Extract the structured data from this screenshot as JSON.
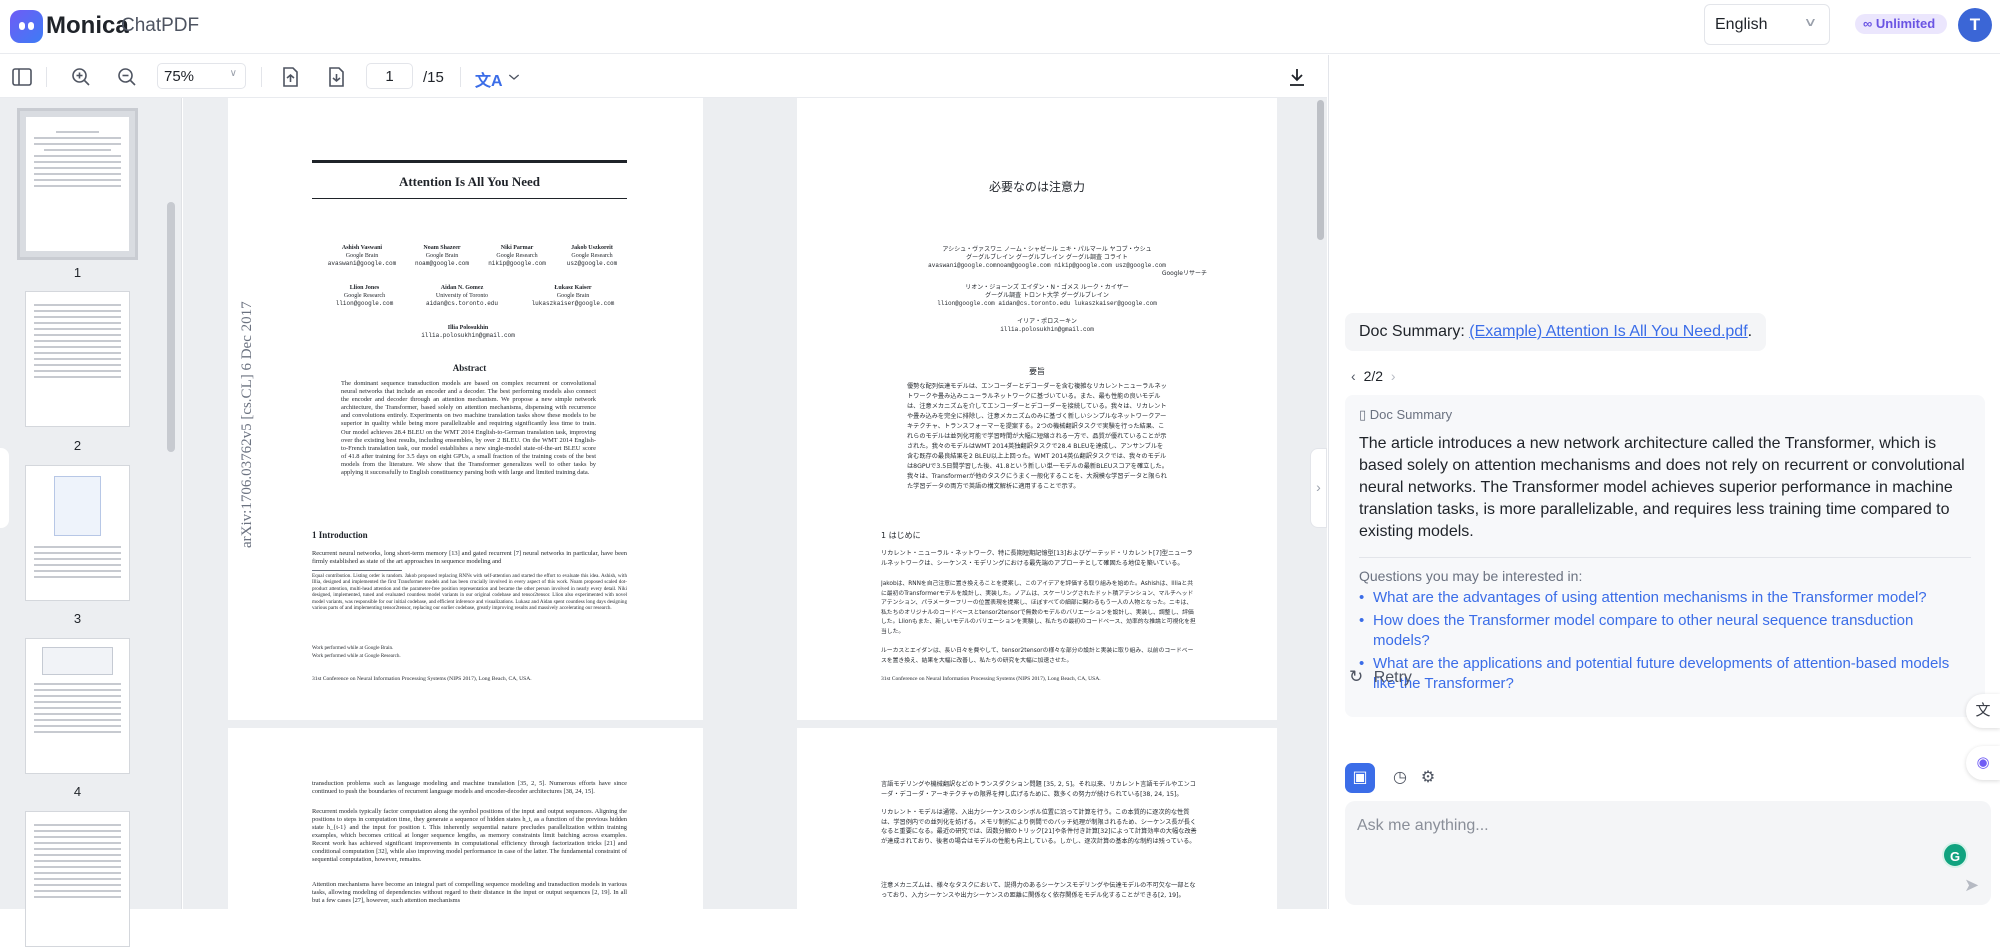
{
  "app": {
    "brand": "Monica",
    "product": "ChatPDF"
  },
  "header": {
    "language": "English",
    "plan_badge": "Unlimited",
    "avatar_initial": "T"
  },
  "toolbar": {
    "zoom": "75%",
    "current_page": "1",
    "total_pages": "/15"
  },
  "thumbnails": [
    {
      "label": "1"
    },
    {
      "label": "2"
    },
    {
      "label": "3"
    },
    {
      "label": "4"
    }
  ],
  "pdf": {
    "side_stamp": "arXiv:1706.03762v5  [cs.CL]  6 Dec 2017",
    "title": "Attention Is All You Need",
    "authors": [
      {
        "name": "Ashish Vaswani",
        "affil": "Google Brain",
        "email": "avaswani@google.com"
      },
      {
        "name": "Noam Shazeer",
        "affil": "Google Brain",
        "email": "noam@google.com"
      },
      {
        "name": "Niki Parmar",
        "affil": "Google Research",
        "email": "nikip@google.com"
      },
      {
        "name": "Jakob Uszkoreit",
        "affil": "Google Research",
        "email": "usz@google.com"
      },
      {
        "name": "Llion Jones",
        "affil": "Google Research",
        "email": "llion@google.com"
      },
      {
        "name": "Aidan N. Gomez",
        "affil": "University of Toronto",
        "email": "aidan@cs.toronto.edu"
      },
      {
        "name": "Łukasz Kaiser",
        "affil": "Google Brain",
        "email": "lukaszkaiser@google.com"
      },
      {
        "name": "Illia Polosukhin",
        "affil": "",
        "email": "illia.polosukhin@gmail.com"
      }
    ],
    "abstract_heading": "Abstract",
    "abstract": "The dominant sequence transduction models are based on complex recurrent or convolutional neural networks that include an encoder and a decoder. The best performing models also connect the encoder and decoder through an attention mechanism. We propose a new simple network architecture, the Transformer, based solely on attention mechanisms, dispensing with recurrence and convolutions entirely. Experiments on two machine translation tasks show these models to be superior in quality while being more parallelizable and requiring significantly less time to train. Our model achieves 28.4 BLEU on the WMT 2014 English-to-German translation task, improving over the existing best results, including ensembles, by over 2 BLEU. On the WMT 2014 English-to-French translation task, our model establishes a new single-model state-of-the-art BLEU score of 41.8 after training for 3.5 days on eight GPUs, a small fraction of the training costs of the best models from the literature. We show that the Transformer generalizes well to other tasks by applying it successfully to English constituency parsing both with large and limited training data.",
    "intro_heading": "1   Introduction",
    "intro": "Recurrent neural networks, long short-term memory [13] and gated recurrent [7] neural networks in particular, have been firmly established as state of the art approaches in sequence modeling and",
    "footnote1": "Equal contribution. Listing order is random. Jakob proposed replacing RNNs with self-attention and started the effort to evaluate this idea. Ashish, with Illia, designed and implemented the first Transformer models and has been crucially involved in every aspect of this work. Noam proposed scaled dot-product attention, multi-head attention and the parameter-free position representation and became the other person involved in nearly every detail. Niki designed, implemented, tuned and evaluated countless model variants in our original codebase and tensor2tensor. Llion also experimented with novel model variants, was responsible for our initial codebase, and efficient inference and visualizations. Lukasz and Aidan spent countless long days designing various parts of and implementing tensor2tensor, replacing our earlier codebase, greatly improving results and massively accelerating our research.",
    "footnote2": "Work performed while at Google Brain.",
    "footnote3": "Work performed while at Google Research.",
    "conference": "31st Conference on Neural Information Processing Systems (NIPS 2017), Long Beach, CA, USA.",
    "p2a": "transduction problems such as language modeling and machine translation [35, 2, 5]. Numerous efforts have since continued to push the boundaries of recurrent language models and encoder-decoder architectures [38, 24, 15].",
    "p2b": "Recurrent models typically factor computation along the symbol positions of the input and output sequences. Aligning the positions to steps in computation time, they generate a sequence of hidden states h_t, as a function of the previous hidden state h_{t-1} and the input for position t. This inherently sequential nature precludes parallelization within training examples, which becomes critical at longer sequence lengths, as memory constraints limit batching across examples. Recent work has achieved significant improvements in computational efficiency through factorization tricks [21] and conditional computation [32], while also improving model performance in case of the latter. The fundamental constraint of sequential computation, however, remains.",
    "p2c": "Attention mechanisms have become an integral part of compelling sequence modeling and transduction models in various tasks, allowing modeling of dependencies without regard to their distance in the input or output sequences [2, 19]. In all but a few cases [27], however, such attention mechanisms"
  },
  "pdf_ja": {
    "title": "必要なのは注意力",
    "authors_line1": "アシシュ・ヴァスワニ  ノーム・シャゼール  ニキ・パルマール  ヤコブ・ウシュ",
    "authors_line2": "グーグルブレイン       グーグルブレイン  グーグル調査              コライト",
    "authors_line3": "avaswani@google.comnoam@google.com nikip@google.com usz@google.com",
    "authors_line4": "Googleリサーチ",
    "authors_line5": "リオン・ジョーンズ     エイダン・N・ゴメス        ルーク・カイザー",
    "authors_line6": "グーグル調査                トロント大学                     グーグルブレイン",
    "authors_line7": "llion@google.com   aidan@cs.toronto.edu  lukaszkaiser@google.com",
    "authors_line8": "イリア・ポロスーキン",
    "authors_line9": "illia.polosukhin@gmail.com",
    "abstract_heading": "要旨",
    "abstract": "優勢な配列伝達モデルは、エンコーダーとデコーダーを含む複雑なリカレントニューラルネットワークや畳み込みニューラルネットワークに基づいている。また、最も性能の良いモデルは、注意メカニズムを介してエンコーダーとデコーダーを接続している。我々は、リカレントや畳み込みを完全に排除し、注意メカニズムのみに基づく新しいシンプルなネットワークアーキテクチャ、トランスフォーマーを提案する。2つの機械翻訳タスクで実験を行った結果、これらのモデルは並列化可能で学習時間が大幅に短縮される一方で、品質が優れていることが示された。我々のモデルはWMT 2014英独翻訳タスクで28.4 BLEUを達成し、アンサンブルを含む既存の最良結果を2 BLEU以上上回った。WMT 2014英仏翻訳タスクでは、我々のモデルは8GPUで3.5日間学習した後、41.8という新しい単一モデルの最新BLEUスコアを確立した。我々は、Transformerが他のタスクにうまく一般化することを、大規模な学習データと限られた学習データの両方で英語の構文解析に適用することで示す。",
    "intro_heading": "1 はじめに",
    "intro": "リカレント・ニューラル・ネットワーク、特に長期短期記憶型[13]およびゲーテッド・リカレント[7]型ニューラルネットワークは、シーケンス・モデリングにおける最先端のアプローチとして確固たる地位を築いている。",
    "footnote": "Jakobは、RNNを自己注意に置き換えることを提案し、このアイデアを評価する取り組みを始めた。Ashishは、Illiaと共に最初のTransformerモデルを設計し、実装した。ノアムは、スケーリングされたドット積アテンション、マルチヘッドアテンション、パラメーターフリーの位置表現を提案し、ほぼすべての細部に関わるもう一人の人物となった。ニキは、私たちのオリジナルのコードベースとtensor2tensorで無数のモデルのバリエーションを設計し、実装し、調整し、評価した。Llionもまた、新しいモデルのバリエーションを実験し、私たちの最初のコードベース、効率的な推論と可視化を担当した。",
    "footnote2": "ルーカスとエイダンは、長い日々を費やして、tensor2tensorの様々な部分の設計と実装に取り組み、以前のコードベースを置き換え、結果を大幅に改善し、私たちの研究を大幅に加速させた。",
    "conference": "31st Conference on Neural Information Processing Systems (NIPS 2017), Long Beach, CA, USA.",
    "p2a": "言語モデリングや機械翻訳などのトランスダクション問題 [35, 2, 5]。それ以来、リカレント言語モデルやエンコーダ・デコーダ・アーキテクチャの限界を押し広げるために、数多くの努力が続けられている[38, 24, 15]。",
    "p2b": "リカレント・モデルは通常、入出力シーケンスのシンボル位置に沿って計算を行う。この本質的に逐次的な性質は、学習例内での並列化を妨げる。メモリ制約により例間でのバッチ処理が制限されるため、シーケンス長が長くなると重要になる。最近の研究では、因数分解のトリック[21]や条件付き計算[32]によって計算効率の大幅な改善が達成されており、後者の場合はモデルの性能も向上している。しかし、逐次計算の基本的な制約は残っている。",
    "p2c": "注意メカニズムは、様々なタスクにおいて、説得力のあるシーケンスモデリングや伝達モデルの不可欠な一部となっており、入力シーケンスや出力シーケンスの距離に関係なく依存関係をモデル化することができる[2, 19]。"
  },
  "chat": {
    "summary_prefix": "Doc Summary: ",
    "summary_link": "(Example) Attention Is All You Need.pdf",
    "summary_suffix": ".",
    "pager": "2/2",
    "response_label": "Doc Summary",
    "response_text": "The article introduces a new network architecture called the Transformer, which is based solely on attention mechanisms and does not rely on recurrent or convolutional neural networks. The Transformer model achieves superior performance in machine translation tasks, is more parallelizable, and requires less training time compared to existing models.",
    "questions_heading": "Questions you may be interested in:",
    "questions": [
      "What are the advantages of using attention mechanisms in the Transformer model?",
      "How does the Transformer model compare to other neural sequence transduction models?",
      "What are the applications and potential future developments of attention-based models like the Transformer?"
    ],
    "retry": "Retry",
    "input_placeholder": "Ask me anything...",
    "model_badge": "G"
  },
  "colors": {
    "accent": "#3b6de8",
    "brand": "#6f5cf5",
    "badge_bg": "#ebe6fd",
    "viewer_bg": "#eceef1"
  }
}
